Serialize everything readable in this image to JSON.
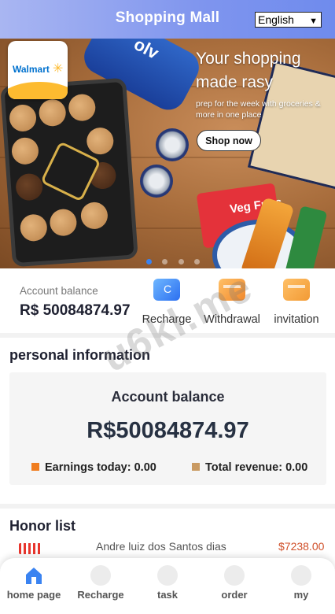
{
  "header": {
    "title": "Shopping Mall",
    "language_selected": "English"
  },
  "banner": {
    "brand_logo_text": "Walmart",
    "title": "Your shopping made rasy",
    "subtitle": "prep for the week with groceries & more in one place",
    "cta_label": "Shop now",
    "bottle_text": "olv",
    "snack_text": "Veg Fries",
    "carousel_dots": 4,
    "active_dot": 1
  },
  "account": {
    "balance_label": "Account balance",
    "balance_value": "R$ 50084874.97",
    "actions": [
      {
        "label": "Recharge",
        "icon": "recharge-card-icon"
      },
      {
        "label": "Withdrawal",
        "icon": "withdraw-card-icon"
      },
      {
        "label": "invitation",
        "icon": "invitation-card-icon"
      }
    ]
  },
  "watermark": "u6kl.me",
  "personal": {
    "title": "personal information",
    "card_label": "Account balance",
    "card_value": "R$50084874.97",
    "earnings_today_label": "Earnings today:",
    "earnings_today_value": "0.00",
    "total_revenue_label": "Total revenue:",
    "total_revenue_value": "0.00",
    "earnings_color": "#f07d1f",
    "revenue_color": "#c99a62"
  },
  "honor": {
    "title": "Honor list",
    "rows": [
      {
        "name": "Andre luiz dos Santos dias",
        "amount": "$7238.00"
      }
    ]
  },
  "bottom_nav": {
    "items": [
      {
        "label": "home page",
        "icon": "home-icon",
        "active": true
      },
      {
        "label": "Recharge",
        "icon": "recharge-icon",
        "active": false
      },
      {
        "label": "task",
        "icon": "task-icon",
        "active": false
      },
      {
        "label": "order",
        "icon": "order-icon",
        "active": false
      },
      {
        "label": "my",
        "icon": "user-icon",
        "active": false
      }
    ]
  },
  "colors": {
    "header_gradient_start": "#a9b6f2",
    "header_gradient_end": "#6f8bed",
    "active_nav": "#3a83f1",
    "honor_amount": "#d0502a"
  }
}
